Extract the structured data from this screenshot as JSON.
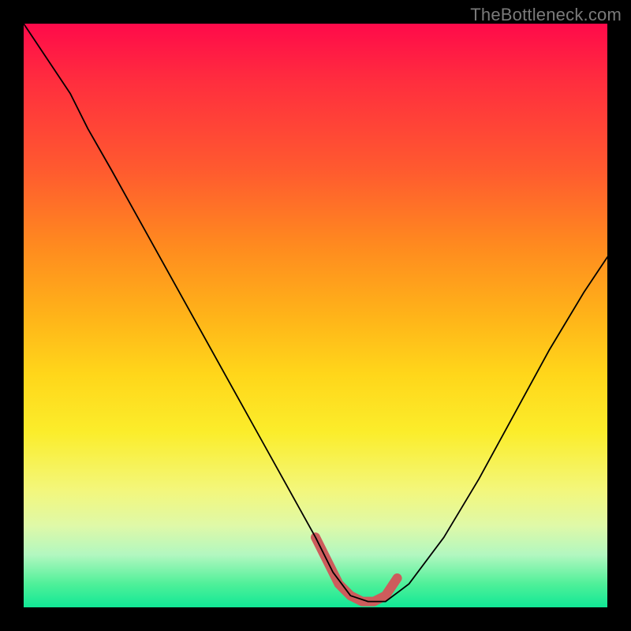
{
  "watermark": "TheBottleneck.com",
  "chart_data": {
    "type": "line",
    "title": "",
    "xlabel": "",
    "ylabel": "",
    "xlim": [
      0,
      100
    ],
    "ylim": [
      0,
      100
    ],
    "grid": false,
    "series": [
      {
        "name": "bottleneck-curve",
        "x": [
          0,
          4,
          8,
          11,
          15,
          20,
          25,
          30,
          35,
          40,
          45,
          50,
          53,
          56,
          59,
          62,
          66,
          72,
          78,
          84,
          90,
          96,
          100
        ],
        "y": [
          100,
          94,
          88,
          82,
          75,
          66,
          57,
          48,
          39,
          30,
          21,
          12,
          6,
          2,
          1,
          1,
          4,
          12,
          22,
          33,
          44,
          54,
          60
        ],
        "stroke": "#000000",
        "stroke_width": 1.8
      }
    ],
    "highlight_segment": {
      "name": "optimal-range",
      "x": [
        50,
        52,
        54,
        56,
        58,
        60,
        62,
        64
      ],
      "y": [
        12,
        8,
        4,
        2,
        1,
        1,
        2,
        5
      ],
      "stroke": "#cd5c5c",
      "stroke_width": 12
    },
    "background_gradient": {
      "stops": [
        {
          "pos": 0,
          "color": "#ff0a4a"
        },
        {
          "pos": 10,
          "color": "#ff2e3e"
        },
        {
          "pos": 25,
          "color": "#ff5a2f"
        },
        {
          "pos": 38,
          "color": "#ff8a1f"
        },
        {
          "pos": 50,
          "color": "#ffb319"
        },
        {
          "pos": 60,
          "color": "#ffd61a"
        },
        {
          "pos": 70,
          "color": "#fbed2b"
        },
        {
          "pos": 80,
          "color": "#f3f77c"
        },
        {
          "pos": 86,
          "color": "#dff9a8"
        },
        {
          "pos": 91,
          "color": "#b2f7c0"
        },
        {
          "pos": 96,
          "color": "#4ff099"
        },
        {
          "pos": 100,
          "color": "#11e896"
        }
      ]
    }
  }
}
